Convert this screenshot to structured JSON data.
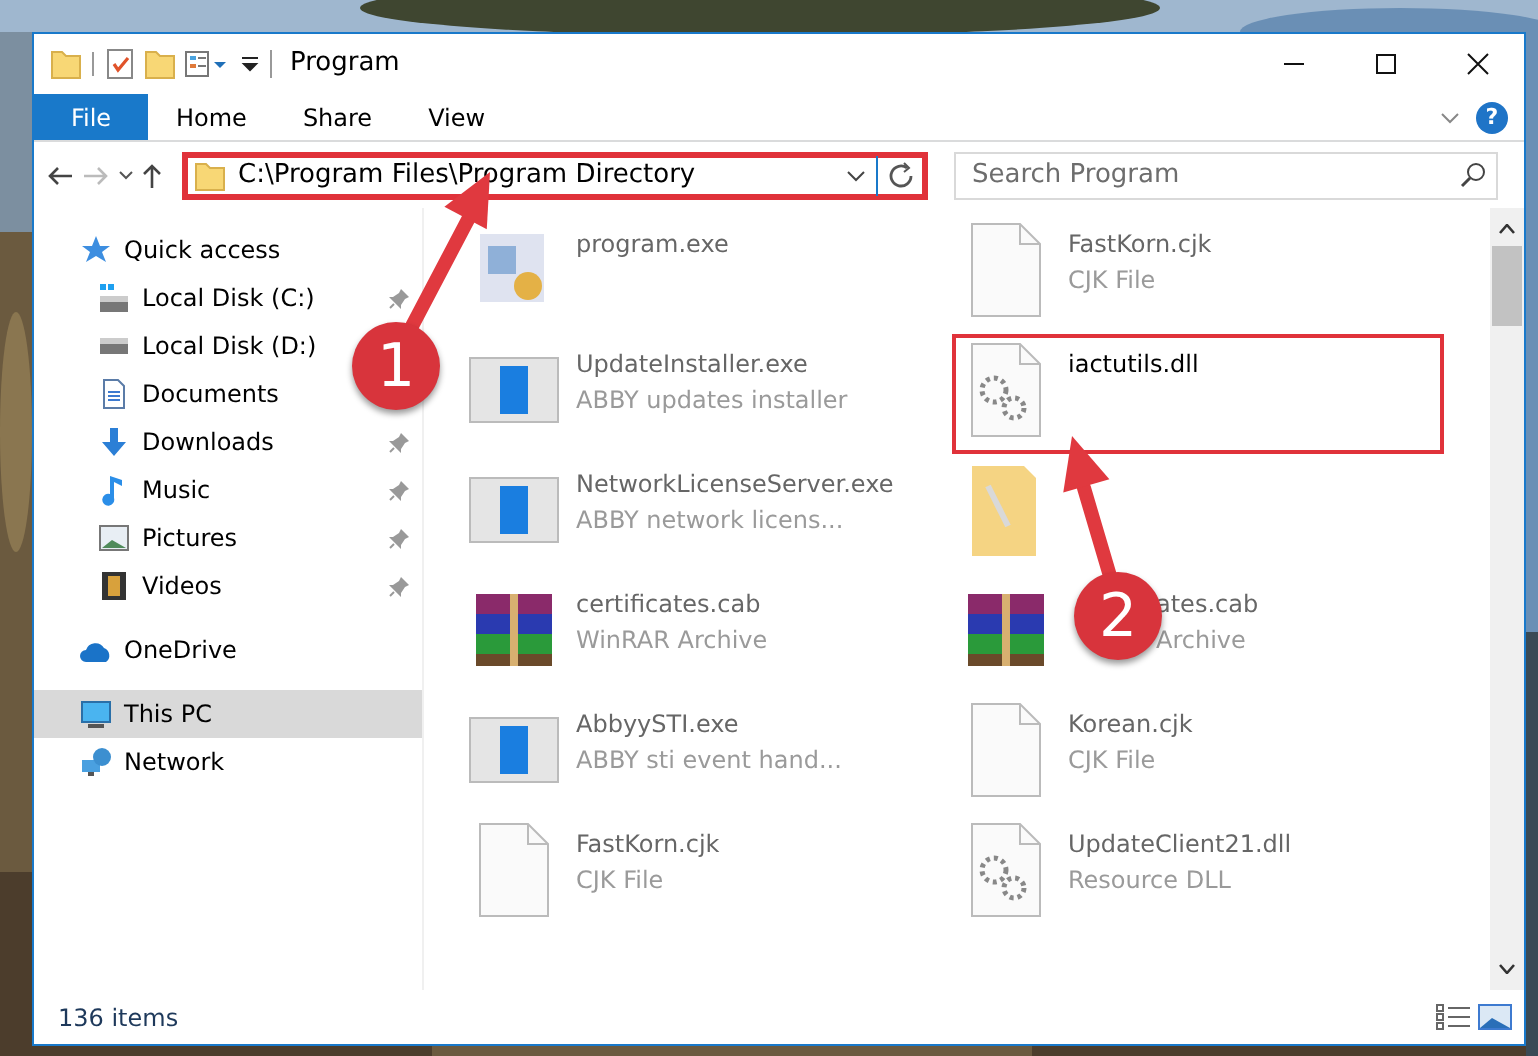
{
  "window": {
    "title": "Program"
  },
  "ribbon": {
    "tabs": [
      {
        "label": "File",
        "kind": "file"
      },
      {
        "label": "Home",
        "kind": "tab"
      },
      {
        "label": "Share",
        "kind": "tab"
      },
      {
        "label": "View",
        "kind": "tab"
      }
    ],
    "help": "?"
  },
  "address": {
    "path": "C:\\Program Files\\Program Directory",
    "highlighted": true
  },
  "search": {
    "placeholder": "Search Program"
  },
  "navigation": [
    {
      "label": "Quick access",
      "kind": "star",
      "selected": false,
      "children": [
        {
          "label": "Local Disk (C:)",
          "kind": "windisk",
          "pinned": true
        },
        {
          "label": "Local Disk (D:)",
          "kind": "disk",
          "pinned": false
        },
        {
          "label": "Documents",
          "kind": "document",
          "pinned": false
        },
        {
          "label": "Downloads",
          "kind": "download",
          "pinned": true
        },
        {
          "label": "Music",
          "kind": "music",
          "pinned": true
        },
        {
          "label": "Pictures",
          "kind": "pictures",
          "pinned": true
        },
        {
          "label": "Videos",
          "kind": "video",
          "pinned": true
        }
      ]
    },
    {
      "label": "OneDrive",
      "kind": "cloud",
      "selected": false
    },
    {
      "label": "This PC",
      "kind": "computer",
      "selected": true
    },
    {
      "label": "Network",
      "kind": "network",
      "selected": false
    }
  ],
  "files": [
    {
      "name": "program.exe",
      "kind": "program",
      "highlighted": false
    },
    {
      "name": "FastKorn.cjk",
      "description": "CJK File",
      "kind": "page",
      "highlighted": false
    },
    {
      "name": "UpdateInstaller.exe",
      "description": "ABBY updates installer",
      "kind": "app",
      "highlighted": false
    },
    {
      "name": "iactutils.dll",
      "kind": "dll",
      "highlighted": true
    },
    {
      "name": "NetworkLicenseServer.exe",
      "description": "ABBY network licens...",
      "kind": "app",
      "highlighted": false
    },
    {
      "kind": "folder",
      "highlighted": false
    },
    {
      "name": "certificates.cab",
      "description": "WinRAR Archive",
      "kind": "archive",
      "highlighted": false
    },
    {
      "name": "ates.cab",
      "description": "Archive",
      "kind": "archive",
      "highlighted": false,
      "partly_covered": true
    },
    {
      "name": "AbbyySTI.exe",
      "description": "ABBY sti event hand...",
      "kind": "app",
      "highlighted": false
    },
    {
      "name": "Korean.cjk",
      "description": "CJK File",
      "kind": "page",
      "highlighted": false
    },
    {
      "name": "FastKorn.cjk",
      "description": "CJK File",
      "kind": "page",
      "highlighted": false
    },
    {
      "name": "UpdateClient21.dll",
      "description": "Resource DLL",
      "kind": "dll",
      "highlighted": false
    }
  ],
  "status_bar": {
    "item_count": "136 items"
  },
  "annotations": [
    {
      "number": "1"
    },
    {
      "number": "2"
    }
  ]
}
